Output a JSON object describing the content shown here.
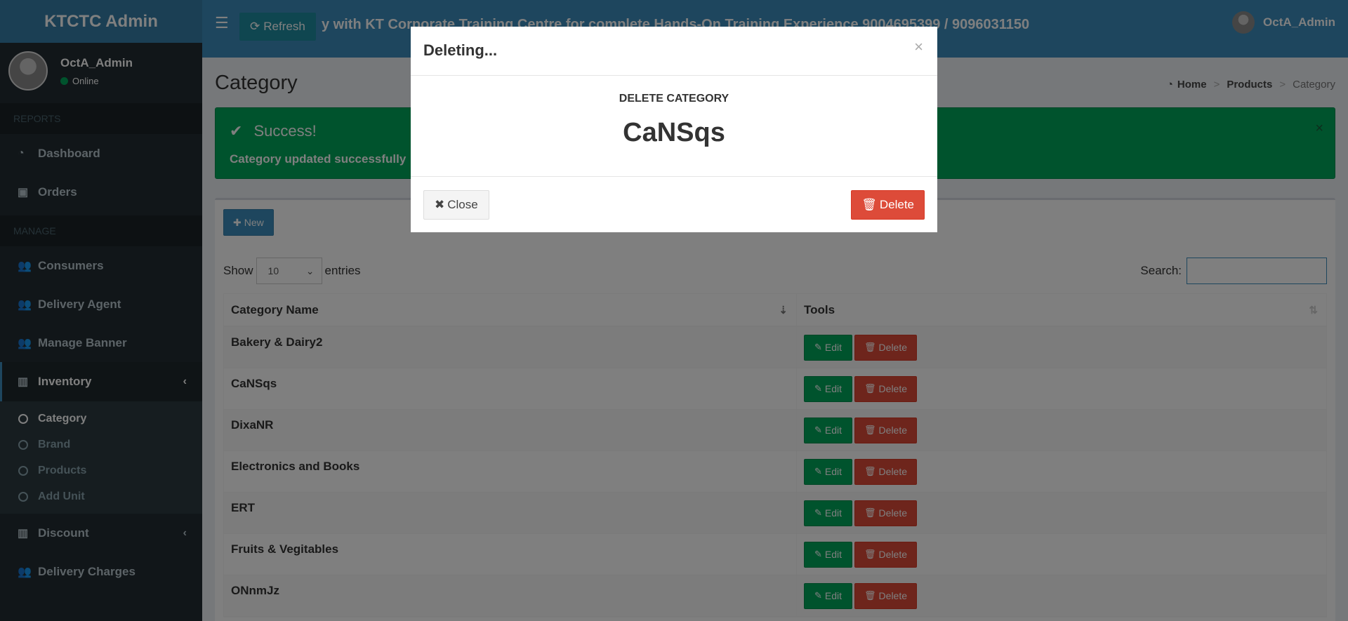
{
  "sidebar": {
    "logo": "KTCTC Admin",
    "user": {
      "name": "OctA_Admin",
      "status": "Online"
    },
    "sections": {
      "reports": "REPORTS",
      "manage": "MANAGE"
    },
    "items": {
      "dashboard": "Dashboard",
      "orders": "Orders",
      "consumers": "Consumers",
      "delivery_agent": "Delivery Agent",
      "manage_banner": "Manage Banner",
      "inventory": "Inventory",
      "discount": "Discount",
      "delivery_charges": "Delivery Charges"
    },
    "inventory_sub": {
      "category": "Category",
      "brand": "Brand",
      "products": "Products",
      "add_unit": "Add Unit"
    }
  },
  "header": {
    "refresh_label": "Refresh",
    "marquee": "y with KT Corporate Training Centre for complete Hands-On Training Experience 9004695399 / 9096031150",
    "user_name": "OctA_Admin"
  },
  "page": {
    "title": "Category",
    "breadcrumb": {
      "home": "Home",
      "products": "Products",
      "category": "Category"
    }
  },
  "alert": {
    "title": "Success!",
    "message": "Category updated successfully",
    "close": "×"
  },
  "table_controls": {
    "new_label": "New",
    "show_label": "Show",
    "entries_value": "10",
    "entries_label": "entries",
    "search_label": "Search:"
  },
  "table": {
    "headers": {
      "name": "Category Name",
      "tools": "Tools"
    },
    "edit_label": "Edit",
    "delete_label": "Delete",
    "rows": [
      "Bakery & Dairy2",
      "CaNSqs",
      "DixaNR",
      "Electronics and Books",
      "ERT",
      "Fruits & Vegitables",
      "ONnmJz"
    ]
  },
  "modal": {
    "title": "Deleting...",
    "close_x": "×",
    "subtitle": "DELETE CATEGORY",
    "name": "CaNSqs",
    "close_label": "Close",
    "delete_label": "Delete"
  }
}
